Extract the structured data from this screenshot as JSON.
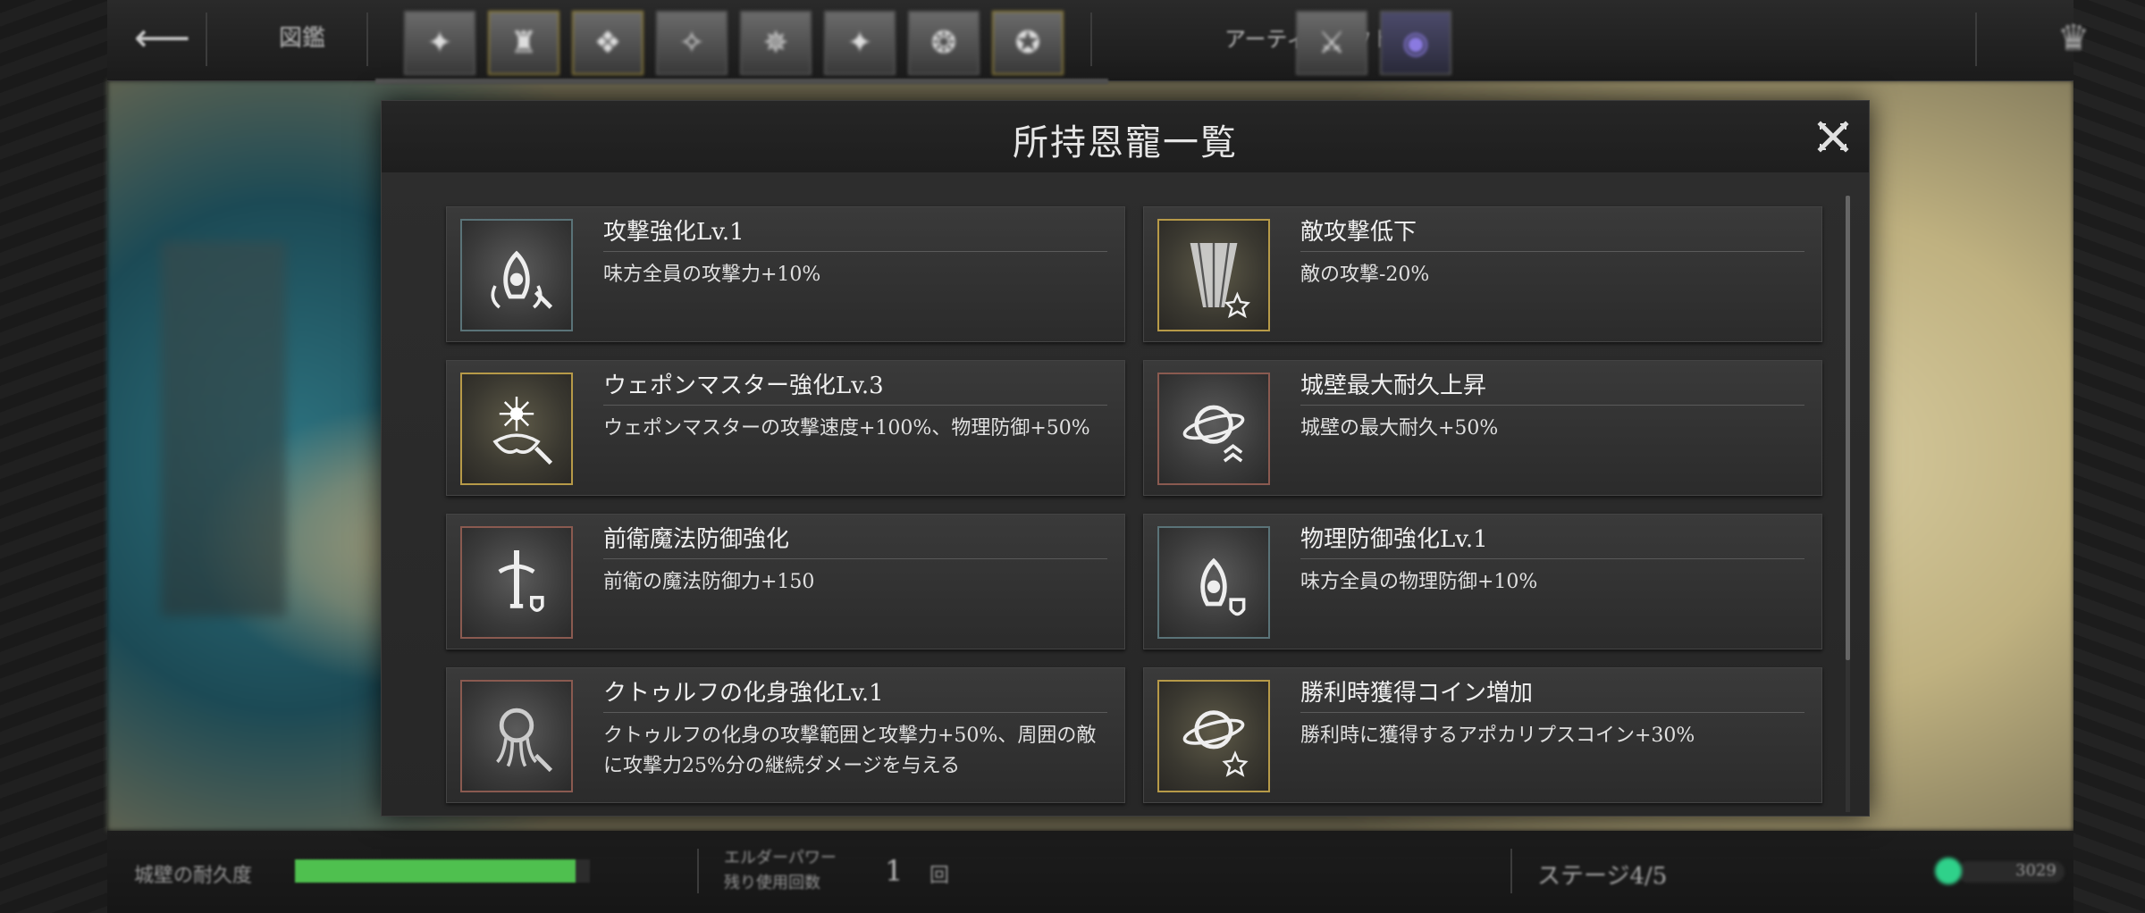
{
  "topbar": {
    "back_icon": "arrow-left-icon",
    "title": "図鑑",
    "slots": [
      {
        "icon": "blessing-slot-icon"
      },
      {
        "icon": "blessing-slot-icon"
      },
      {
        "icon": "blessing-slot-icon"
      },
      {
        "icon": "blessing-slot-icon"
      },
      {
        "icon": "blessing-slot-icon"
      },
      {
        "icon": "blessing-slot-icon"
      },
      {
        "icon": "blessing-slot-icon"
      },
      {
        "icon": "blessing-slot-icon"
      }
    ],
    "artifact_label": "アーティファクト",
    "artifact_slots": [
      {
        "icon": "sword-artifact-icon"
      },
      {
        "icon": "purple-orb-artifact-icon"
      }
    ],
    "crown_icon": "crown-icon"
  },
  "modal": {
    "title": "所持恩寵一覧",
    "close_icon": "close-icon",
    "blessings": [
      {
        "name": "攻撃強化Lv.1",
        "desc": "味方全員の攻撃力+10%",
        "icon": "warrior-sword-emblem-icon",
        "frame": "teal"
      },
      {
        "name": "敵攻撃低下",
        "desc": "敵の攻撃-20%",
        "icon": "light-beam-star-icon",
        "frame": "gold"
      },
      {
        "name": "ウェポンマスター強化Lv.3",
        "desc": "ウェポンマスターの攻撃速度+100%、物理防御+50%",
        "icon": "radiant-sword-emblem-icon",
        "frame": "gold"
      },
      {
        "name": "城壁最大耐久上昇",
        "desc": "城壁の最大耐久+50%",
        "icon": "planet-wave-icon",
        "frame": "red"
      },
      {
        "name": "前衛魔法防御強化",
        "desc": "前衛の魔法防御力+150",
        "icon": "sword-shield-emblem-icon",
        "frame": "red"
      },
      {
        "name": "物理防御強化Lv.1",
        "desc": "味方全員の物理防御+10%",
        "icon": "warrior-shield-emblem-icon",
        "frame": "teal"
      },
      {
        "name": "クトゥルフの化身強化Lv.1",
        "desc": "クトゥルフの化身の攻撃範囲と攻撃力+50%、周囲の敵に攻撃力25%分の継続ダメージを与える",
        "icon": "cthulhu-sword-icon",
        "frame": "red"
      },
      {
        "name": "勝利時獲得コイン増加",
        "desc": "勝利時に獲得するアポカリプスコイン+30%",
        "icon": "planet-star-icon",
        "frame": "gold"
      }
    ]
  },
  "bottombar": {
    "wall_label": "城壁の耐久度",
    "wall_ratio": 0.95,
    "power_label_1": "エルダーパワー",
    "power_label_2": "残り使用回数",
    "power_count": "1",
    "power_unit": "回",
    "stage": "ステージ4/5",
    "coins": "3029",
    "colors": {
      "wall_bar": "#4fc04f",
      "coin": "#2fd18a"
    }
  }
}
